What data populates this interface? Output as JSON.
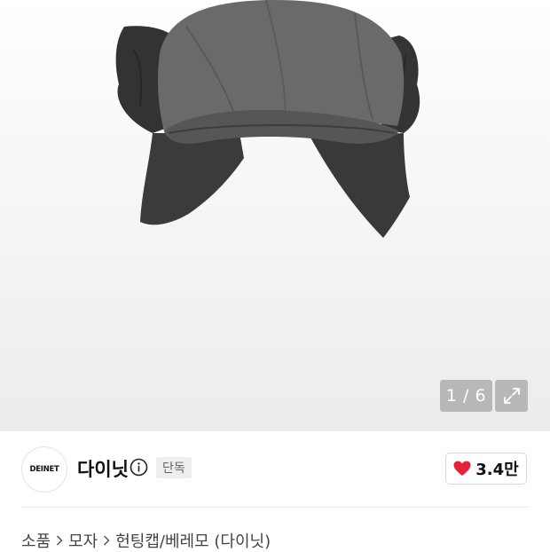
{
  "gallery": {
    "image_alt": "헌팅캡/베레모 (다이닛)",
    "pager": "1 / 6",
    "expand_icon": "expand-icon"
  },
  "brand": {
    "logo_text": "DEINET",
    "name": "다이닛",
    "info_icon": "info-icon",
    "badge": "단독"
  },
  "like": {
    "icon": "heart-icon",
    "count": "3.4만",
    "color": "#e8213b"
  },
  "breadcrumb": {
    "items": [
      "소품",
      "모자",
      "헌팅캡/베레모 (다이닛)"
    ],
    "separator_icon": "chevron-right-icon"
  }
}
